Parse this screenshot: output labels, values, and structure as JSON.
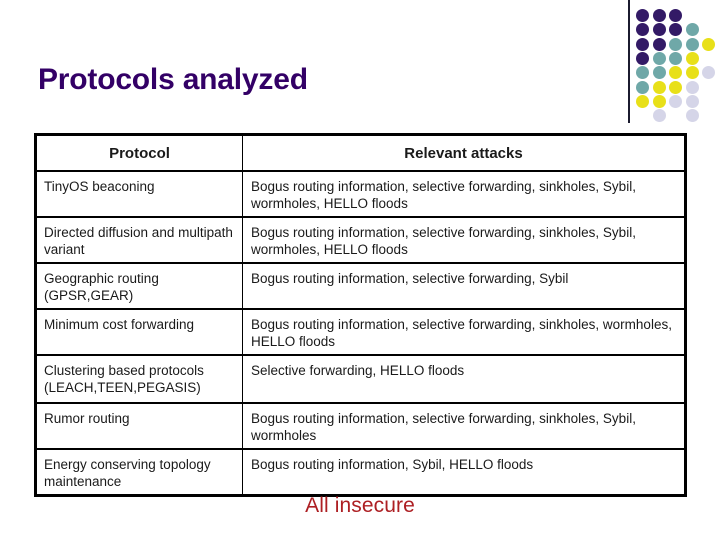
{
  "slide": {
    "title": "Protocols analyzed",
    "footer_note": "All insecure",
    "title_color": "#330066",
    "footer_color": "#AD1F23",
    "background_color": "#FFFFFF"
  },
  "decoration": {
    "name": "dot-grid",
    "rule_color": "#1B1B2F",
    "palette": {
      "purple": "#331A66",
      "deep_purple": "#2E0A5B",
      "teal": "#6FA8A8",
      "yellow": "#E8E019",
      "lavender": "#D5D5E8"
    },
    "rows": [
      [
        "purple",
        "purple",
        "purple",
        null,
        null
      ],
      [
        "purple",
        "purple",
        "purple",
        "teal",
        null
      ],
      [
        "purple",
        "purple",
        "teal",
        "teal",
        "yellow"
      ],
      [
        "purple",
        "teal",
        "teal",
        "yellow",
        null
      ],
      [
        "teal",
        "teal",
        "yellow",
        "yellow",
        "lavender"
      ],
      [
        "teal",
        "yellow",
        "yellow",
        "lavender",
        null
      ],
      [
        "yellow",
        "yellow",
        "lavender",
        "lavender",
        null
      ],
      [
        null,
        "lavender",
        null,
        "lavender",
        null
      ]
    ]
  },
  "table": {
    "border_color": "#000000",
    "columns": [
      {
        "key": "protocol",
        "label": "Protocol"
      },
      {
        "key": "attacks",
        "label": "Relevant attacks"
      }
    ],
    "rows": [
      {
        "protocol": "TinyOS beaconing",
        "attacks": "Bogus routing information, selective forwarding, sinkholes, Sybil, wormholes, HELLO floods"
      },
      {
        "protocol": "Directed diffusion and multipath variant",
        "attacks": "Bogus routing information, selective forwarding, sinkholes, Sybil, wormholes, HELLO floods"
      },
      {
        "protocol": "Geographic routing (GPSR,GEAR)",
        "attacks": "Bogus routing information, selective forwarding, Sybil"
      },
      {
        "protocol": "Minimum cost forwarding",
        "attacks": "Bogus routing information, selective forwarding, sinkholes, wormholes, HELLO floods"
      },
      {
        "protocol": "Clustering based protocols (LEACH,TEEN,PEGASIS)",
        "attacks": "Selective forwarding, HELLO floods"
      },
      {
        "protocol": "Rumor routing",
        "attacks": "Bogus routing information, selective forwarding, sinkholes, Sybil, wormholes"
      },
      {
        "protocol": "Energy conserving topology maintenance",
        "attacks": "Bogus routing information, Sybil, HELLO floods"
      }
    ]
  }
}
